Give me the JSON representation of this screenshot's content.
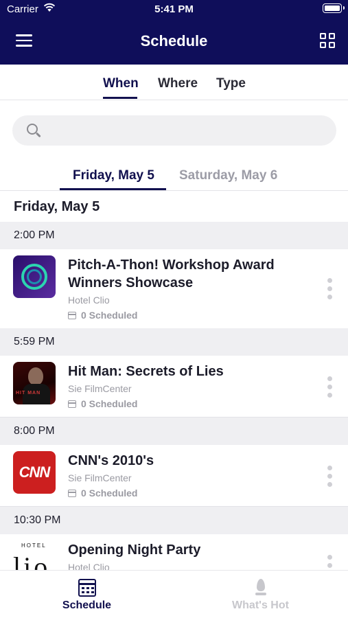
{
  "status_bar": {
    "carrier": "Carrier",
    "time": "5:41 PM"
  },
  "header": {
    "title": "Schedule"
  },
  "filter_tabs": [
    {
      "label": "When",
      "active": true
    },
    {
      "label": "Where",
      "active": false
    },
    {
      "label": "Type",
      "active": false
    }
  ],
  "search": {
    "placeholder": ""
  },
  "date_tabs": [
    {
      "label": "Friday, May 5",
      "active": true
    },
    {
      "label": "Saturday, May 6",
      "active": false
    }
  ],
  "day_heading": "Friday, May 5",
  "sections": [
    {
      "time": "2:00 PM",
      "event": {
        "title": "Pitch-A-Thon! Workshop Award Winners Showcase",
        "venue": "Hotel Clio",
        "scheduled": "0 Scheduled",
        "thumb": "pitch-a-thon-logo"
      }
    },
    {
      "time": "5:59 PM",
      "event": {
        "title": "Hit Man: Secrets of Lies",
        "venue": "Sie FilmCenter",
        "scheduled": "0 Scheduled",
        "thumb": "hit-man-poster",
        "thumb_text": "HIT MAN"
      }
    },
    {
      "time": "8:00 PM",
      "event": {
        "title": "CNN's 2010's",
        "venue": "Sie FilmCenter",
        "scheduled": "0 Scheduled",
        "thumb": "cnn-logo",
        "thumb_text": "CNN"
      }
    },
    {
      "time": "10:30 PM",
      "event": {
        "title": "Opening Night Party",
        "venue": "Hotel Clio",
        "scheduled": "",
        "thumb": "hotel-clio-logo",
        "thumb_text": "HOTEL"
      }
    }
  ],
  "tab_bar": [
    {
      "label": "Schedule",
      "icon": "calendar-icon",
      "active": true
    },
    {
      "label": "What's Hot",
      "icon": "flame-icon",
      "active": false
    }
  ],
  "colors": {
    "primary": "#0f0e5a",
    "inactive": "#c7c7cc",
    "section_bg": "#efeff2",
    "muted_text": "#9a9aa2"
  }
}
